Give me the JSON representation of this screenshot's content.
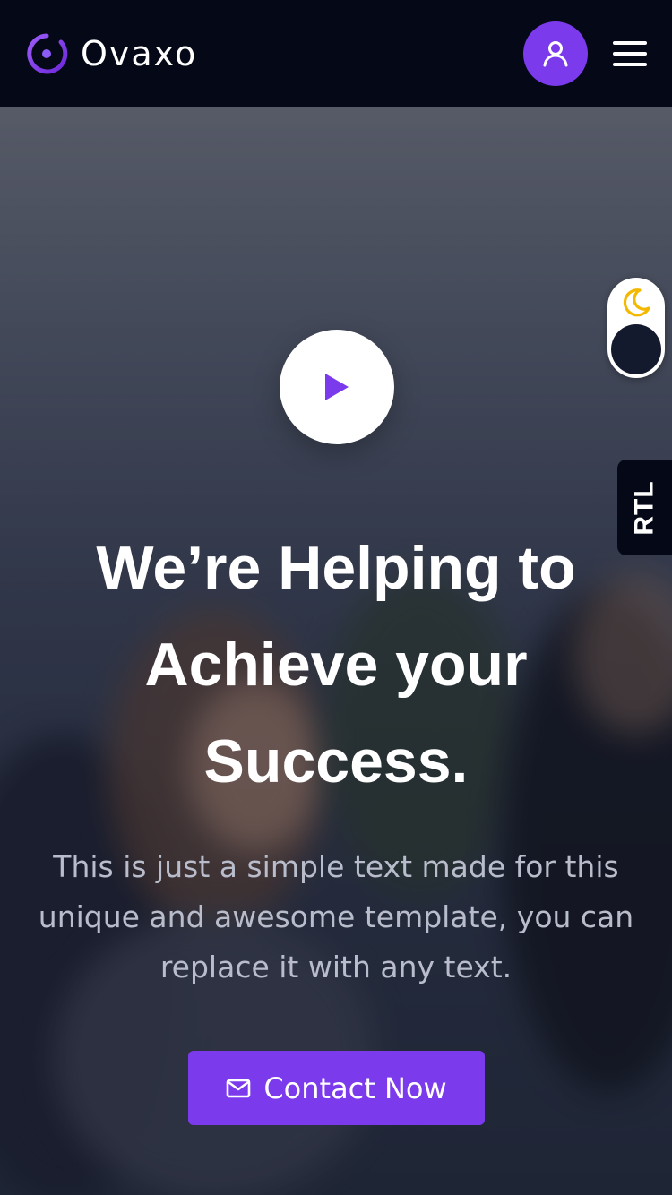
{
  "header": {
    "logo_text": "Ovaxo",
    "logo_icon": "ring-dot-icon",
    "user_icon": "user-icon",
    "menu_icon": "hamburger-menu-icon"
  },
  "hero": {
    "play_icon": "play-icon",
    "title": "We’re Helping to Achieve your Success.",
    "description": "This is just a simple text made for this unique and awesome template, you can replace it with any text.",
    "cta_label": "Contact Now",
    "cta_icon": "mail-icon"
  },
  "theme_toggle": {
    "icon": "moon-icon",
    "state": "dark"
  },
  "rtl_tab": {
    "label": "RTL"
  },
  "colors": {
    "accent": "#7c3aed",
    "header_bg": "#050816",
    "moon": "#f5b800",
    "text_primary": "#ffffff",
    "text_muted": "#b8bccb"
  }
}
